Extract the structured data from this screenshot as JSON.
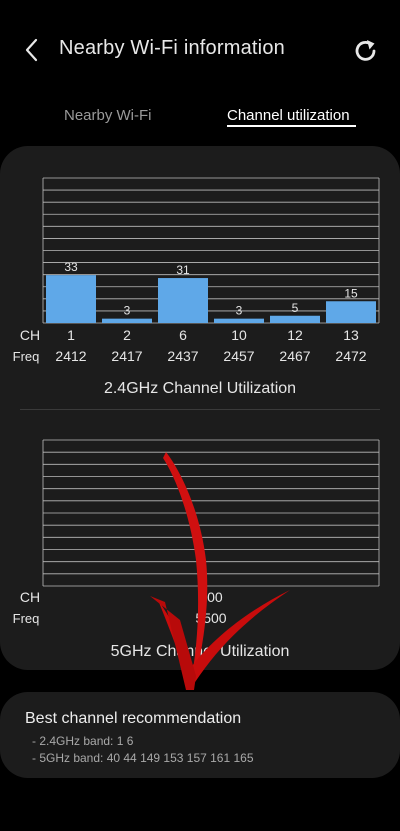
{
  "header": {
    "title": "Nearby Wi-Fi information",
    "back_icon": "chevron-left-icon",
    "refresh_icon": "refresh-icon"
  },
  "tabs": [
    {
      "label": "Nearby Wi-Fi",
      "selected": false
    },
    {
      "label": "Channel utilization",
      "selected": true
    }
  ],
  "chart_data": [
    {
      "type": "bar",
      "title": "2.4GHz Channel Utilization",
      "row_labels": {
        "channel": "CH",
        "frequency": "Freq"
      },
      "categories": [
        "1",
        "2",
        "6",
        "10",
        "12",
        "13"
      ],
      "frequencies": [
        "2412",
        "2417",
        "2437",
        "2457",
        "2467",
        "2472"
      ],
      "values": [
        33,
        3,
        31,
        3,
        5,
        15
      ],
      "ylim": [
        0,
        100
      ],
      "bar_color": "#5fa8e8",
      "grid": true
    },
    {
      "type": "bar",
      "title": "5GHz Channel Utilization",
      "row_labels": {
        "channel": "CH",
        "frequency": "Freq"
      },
      "categories": [
        "100"
      ],
      "frequencies": [
        "5500"
      ],
      "values": [
        0
      ],
      "ylim": [
        0,
        100
      ],
      "bar_color": "#5fa8e8",
      "grid": true
    }
  ],
  "recommendation": {
    "title": "Best channel recommendation",
    "band_24": "- 2.4GHz band: 1 6",
    "band_5": "- 5GHz band: 40 44 149 153 157 161 165"
  },
  "overlay": {
    "arrow_color": "#d01010",
    "arrow_icon": "red-arrow-down-icon"
  }
}
